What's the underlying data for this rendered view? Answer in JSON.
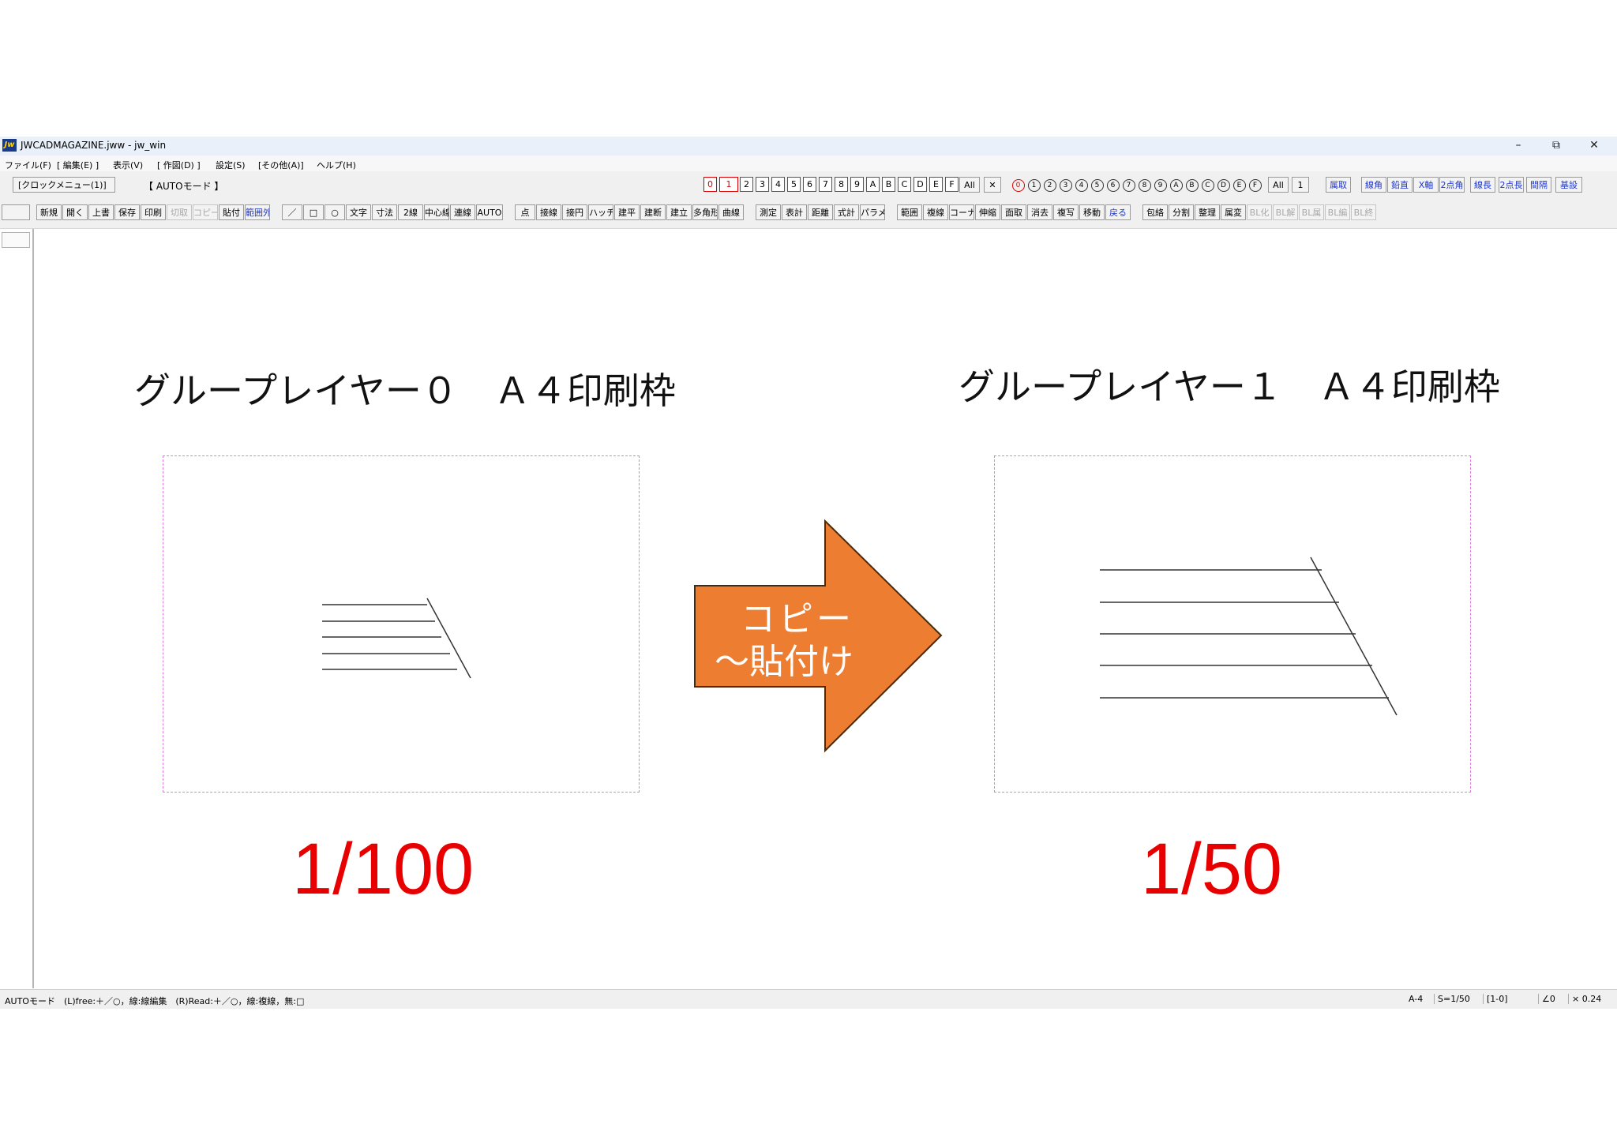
{
  "window": {
    "title": "JWCADMAGAZINE.jww - jw_win",
    "app_icon": "Jw",
    "controls": {
      "minimize": "–",
      "restore": "⧉",
      "close": "✕"
    }
  },
  "menu": [
    "ファイル(F)",
    "[ 編集(E) ]",
    "表示(V)",
    "[ 作図(D) ]",
    "設定(S)",
    "[その他(A)]",
    "ヘルプ(H)"
  ],
  "toolbar1": {
    "clock_menu": "[クロックメニュー(1)]",
    "mode": "【 AUTOモード 】",
    "layers": [
      "0",
      "1",
      "2",
      "3",
      "4",
      "5",
      "6",
      "7",
      "8",
      "9",
      "A",
      "B",
      "C",
      "D",
      "E",
      "F"
    ],
    "layers_all": "All",
    "layers_x": "✕",
    "group_layers": [
      "0",
      "1",
      "2",
      "3",
      "4",
      "5",
      "6",
      "7",
      "8",
      "9",
      "A",
      "B",
      "C",
      "D",
      "E",
      "F"
    ],
    "group_all": "All",
    "group_num": "1",
    "right_buttons": [
      "属取",
      "線角",
      "鉛直",
      "X軸",
      "2点角",
      "線長",
      "2点長",
      "間隔",
      "基設"
    ]
  },
  "toolbar2": [
    "新規",
    "開く",
    "上書",
    "保存",
    "印刷",
    "切取",
    "コピー",
    "貼付",
    "範囲外",
    "／",
    "□",
    "○",
    "文字",
    "寸法",
    "2線",
    "中心線",
    "連線",
    "AUTO",
    "点",
    "接線",
    "接円",
    "ハッチ",
    "建平",
    "建断",
    "建立",
    "多角形",
    "曲線",
    "測定",
    "表計",
    "距離",
    "式計",
    "パラメ",
    "範囲",
    "複線",
    "コーナー",
    "伸縮",
    "面取",
    "消去",
    "複写",
    "移動",
    "戻る",
    "包絡",
    "分割",
    "整理",
    "属変",
    "BL化",
    "BL解",
    "BL属",
    "BL編",
    "BL終"
  ],
  "canvas": {
    "left_heading": "グループレイヤー０　Ａ４印刷枠",
    "right_heading": "グループレイヤー１　Ａ４印刷枠",
    "arrow_line1": "コピー",
    "arrow_line2": "～貼付け",
    "left_scale": "1/100",
    "right_scale": "1/50"
  },
  "status": {
    "left": "AUTOモード　(L)free:＋／○，線:線編集　(R)Read:＋／○，線:複線，無:□",
    "paper": "A-4",
    "scale": "S=1/50",
    "layer": "[1-0]",
    "angle": "∠0",
    "factor": "× 0.24"
  },
  "colors": {
    "frame": "#e37ee0",
    "arrow": "#ed7d31",
    "scale_text": "#e80000",
    "accent_blue": "#1f37c9"
  }
}
